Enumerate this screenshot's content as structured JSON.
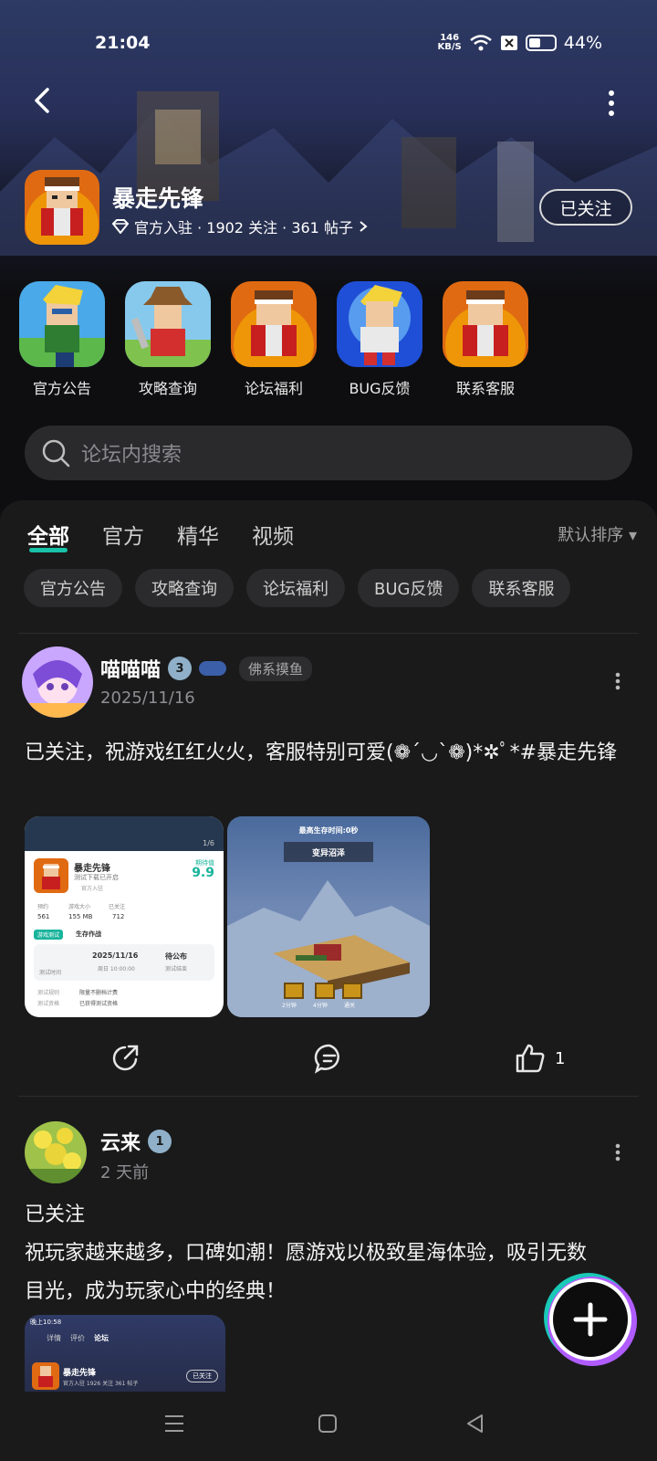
{
  "status_bar": {
    "time": "21:04",
    "speed_value": "146",
    "speed_unit": "KB/S",
    "battery": "44%"
  },
  "game": {
    "name": "暴走先锋",
    "meta": "官方入驻 · 1902 关注 · 361 帖子",
    "follow_label": "已关注"
  },
  "shortcuts": [
    {
      "label": "官方公告",
      "icon": "hero-blond-icon"
    },
    {
      "label": "攻略查询",
      "icon": "hero-cowboy-icon"
    },
    {
      "label": "论坛福利",
      "icon": "hero-headband-icon"
    },
    {
      "label": "BUG反馈",
      "icon": "hero-blond-blue-icon"
    },
    {
      "label": "联系客服",
      "icon": "hero-headband-icon"
    }
  ],
  "search": {
    "placeholder": "论坛内搜索"
  },
  "tabs": [
    {
      "label": "全部",
      "active": true
    },
    {
      "label": "官方"
    },
    {
      "label": "精华"
    },
    {
      "label": "视频"
    }
  ],
  "sort_label": "默认排序 ▾",
  "chips": [
    "官方公告",
    "攻略查询",
    "论坛福利",
    "BUG反馈",
    "联系客服"
  ],
  "posts": [
    {
      "author": "喵喵喵",
      "level": "3",
      "tag": "佛系摸鱼",
      "date": "2025/11/16",
      "text": "已关注，祝游戏红红火火，客服特别可爱(❁´◡`❁)*✲ﾟ*#暴走先锋",
      "likes": "1",
      "shot1": {
        "title": "暴走先锋",
        "subtitle": "测试下载已开启",
        "official": "官方入驻",
        "rating_label": "期待值",
        "rating": "9.9",
        "stats": [
          {
            "v": "561",
            "k": "预约"
          },
          {
            "v": "155 MB",
            "k": "游戏大小"
          },
          {
            "v": "712",
            "k": "已关注"
          }
        ],
        "test_badge": "游戏测试",
        "test_name": "生存作战",
        "date1": "2025/11/16",
        "date1_sub": "周日 10:00:00",
        "date2": "待公布",
        "date2_sub": "测试结束",
        "test_time_label": "测试时间",
        "row1_k": "测试规则",
        "row1_v": "限量不删档计费",
        "row2_k": "测试资格",
        "row2_v": "已获得测试资格",
        "page": "1/6"
      },
      "shot2": {
        "top": "最高生存时间:0秒",
        "banner": "变异沼泽",
        "c1": "2分钟",
        "c2": "4分钟",
        "c3": "通关"
      }
    },
    {
      "author": "云来",
      "level": "1",
      "date": "2 天前",
      "line1": "已关注",
      "line2": "祝玩家越来越多，口碑如潮！愿游戏以极致星海体验，吸引无数目光，成为玩家心中的经典！",
      "shot": {
        "time": "晚上10:58",
        "tabs": [
          "详情",
          "评价",
          "论坛"
        ],
        "name": "暴走先锋",
        "meta": "官方入驻 1926 关注 361 帖子",
        "follow": "已关注"
      }
    }
  ]
}
